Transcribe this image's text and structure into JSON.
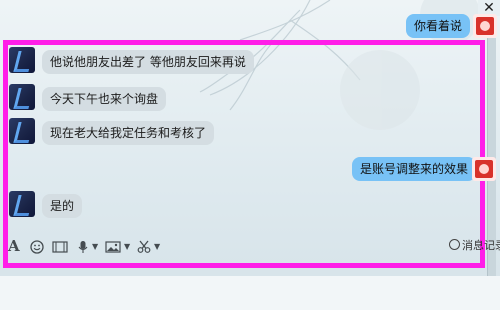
{
  "window": {
    "close_glyph": "✕"
  },
  "messages": [
    {
      "side": "right",
      "text": "你看着说"
    },
    {
      "side": "left",
      "text": "他说他朋友出差了  等他朋友回来再说"
    },
    {
      "side": "left",
      "text": "今天下午也来个询盘"
    },
    {
      "side": "left",
      "text": "现在老大给我定任务和考核了"
    },
    {
      "side": "right",
      "text": "是账号调整来的效果"
    },
    {
      "side": "left",
      "text": "是的"
    }
  ],
  "toolbar": {
    "font_icon": "A",
    "emoji_icon": "smiley-icon",
    "history_label": "消息记录"
  },
  "colors": {
    "highlight_border": "#ff1ee8",
    "self_bubble": "#78c2f6",
    "other_bubble": "#d4dde2"
  }
}
